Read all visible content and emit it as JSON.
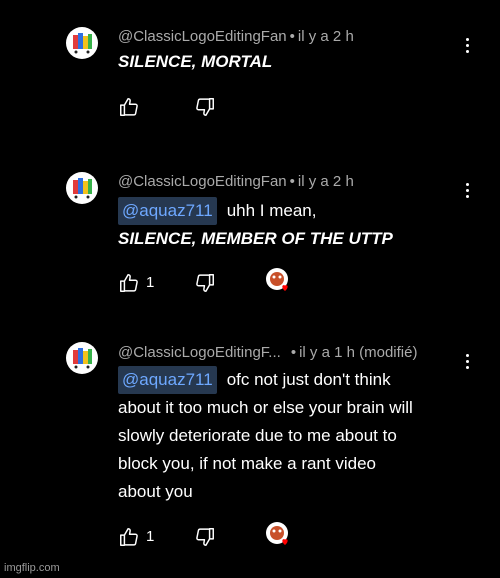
{
  "comments": [
    {
      "author": "@ClassicLogoEditingFan",
      "time": "il y a 2 h",
      "mention": "",
      "lines": [
        "SILENCE, MORTAL"
      ],
      "likes": ""
    },
    {
      "author": "@ClassicLogoEditingFan",
      "time": "il y a 2 h",
      "mention": "@aquaz711",
      "first_line": "uhh I mean,",
      "lines": [
        "SILENCE, MEMBER OF THE UTTP"
      ],
      "likes": "1"
    },
    {
      "author": "@ClassicLogoEditingF...",
      "time": "il y a 1 h (modifié)",
      "mention": "@aquaz711",
      "first_line": "ofc not just don't think",
      "lines": [
        "about it too much or else your brain will",
        "slowly deteriorate due to me about to",
        "block you, if not make a rant video",
        "about you"
      ],
      "likes": "1"
    }
  ],
  "watermark": "imgflip.com",
  "icons": [
    "like-icon",
    "dislike-icon",
    "more-vert-icon",
    "creator-heart-icon"
  ],
  "colors": {
    "background": "#000000",
    "mention_bg": "#263850",
    "mention_text": "#6ea8ff",
    "heart": "#ff0000"
  }
}
